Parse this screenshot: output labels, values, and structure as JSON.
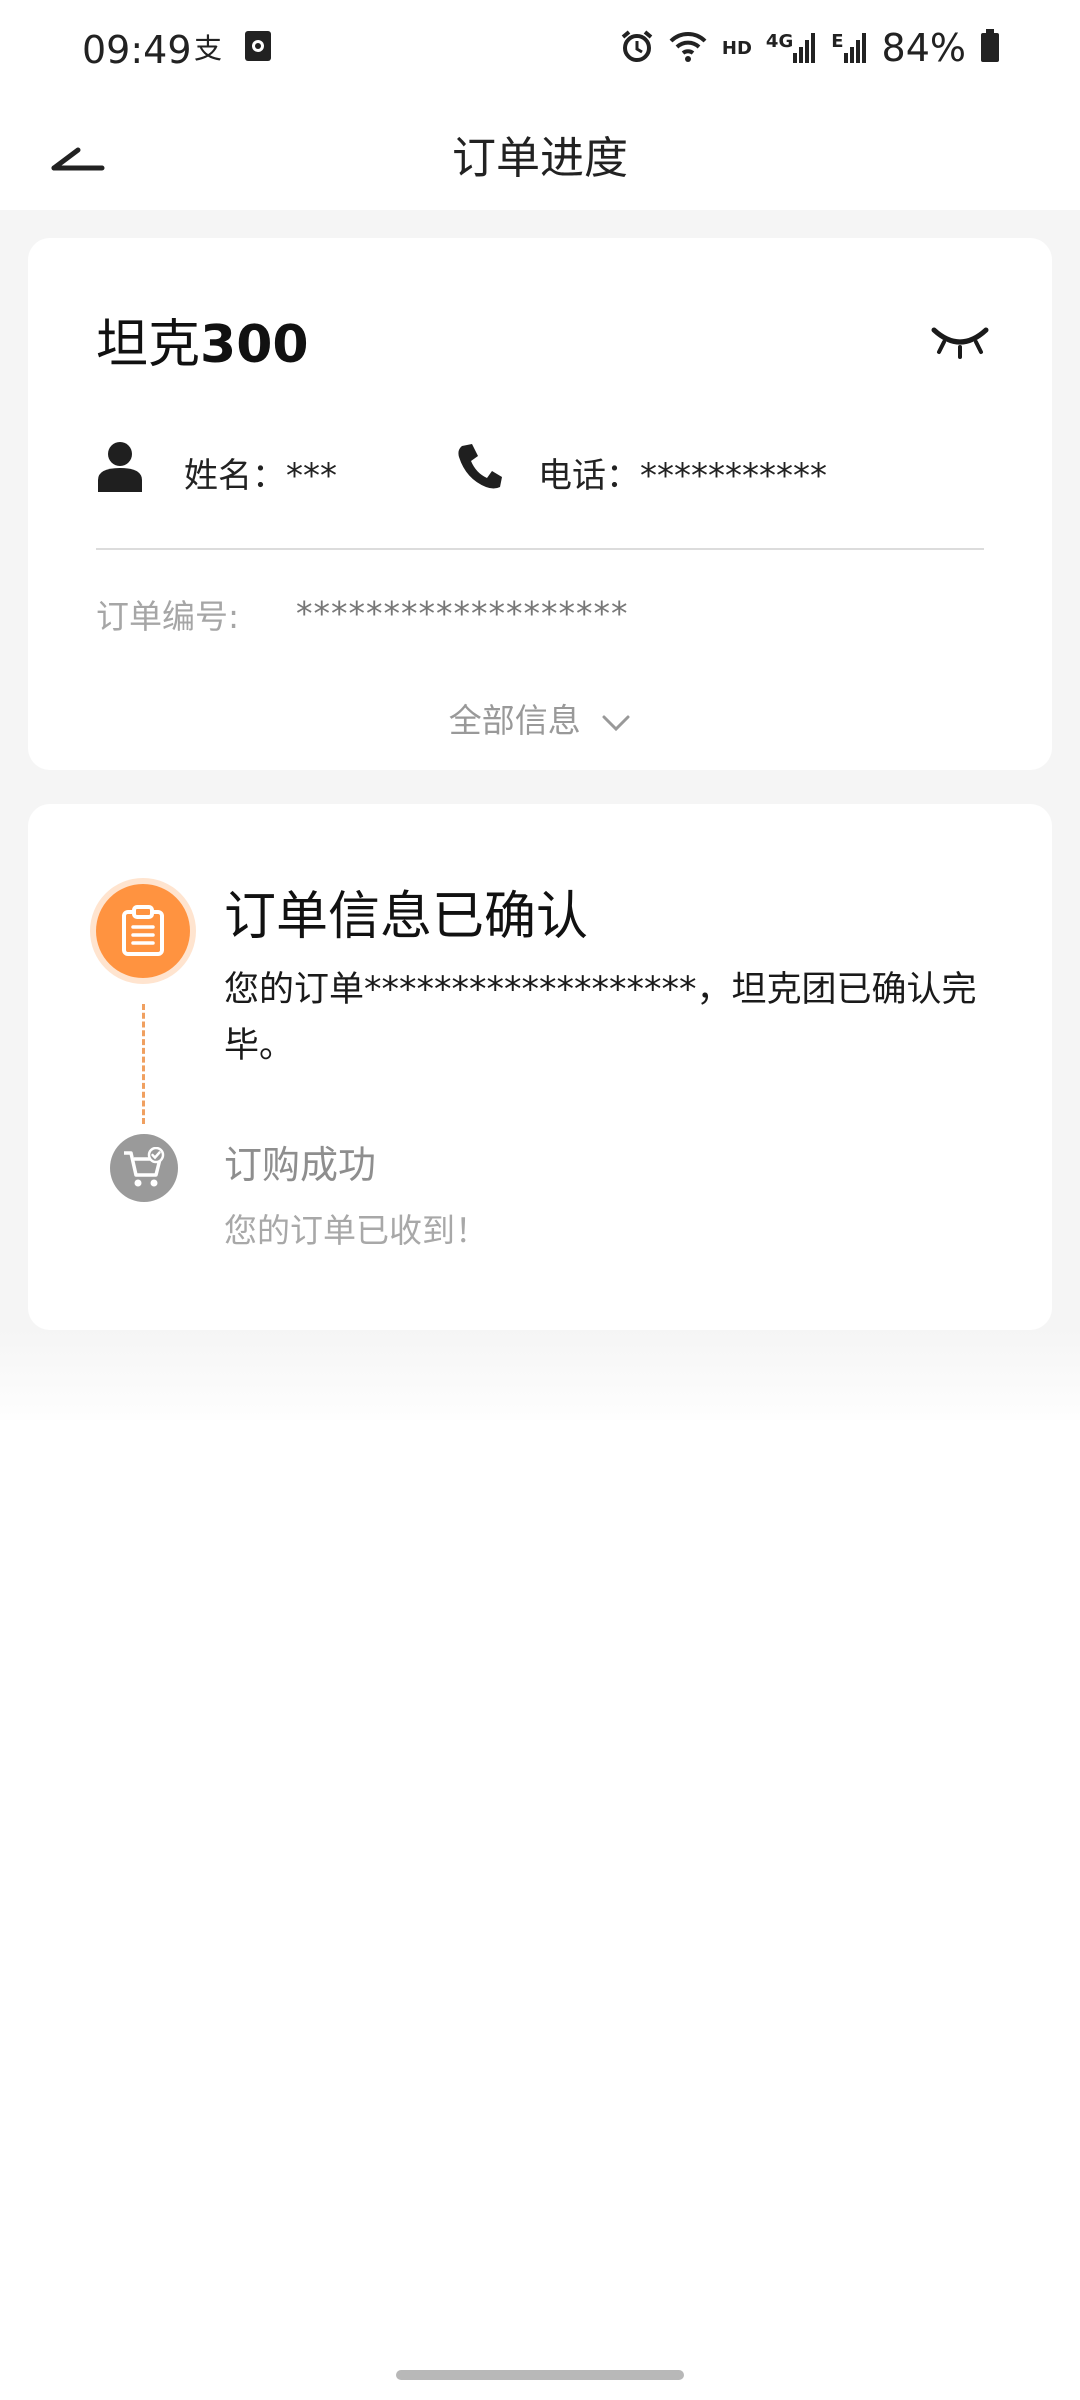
{
  "status_bar": {
    "time": "09:49",
    "left_icons": [
      "alipay-icon",
      "app-notification-icon"
    ],
    "right_icons": [
      "alarm-icon",
      "wifi-icon",
      "hd-icon",
      "signal-4g-icon",
      "signal-e-icon",
      "battery-icon"
    ],
    "hd_label": "HD",
    "net_4g_label": "4G",
    "net_e_label": "E",
    "battery": "84%"
  },
  "header": {
    "title": "订单进度"
  },
  "order_card": {
    "model_prefix": "坦克",
    "model_number": "300",
    "name_text": "姓名：***",
    "phone_text": "电话：***********",
    "order_no_label": "订单编号:",
    "order_no_value": "*******************",
    "all_info_label": "全部信息"
  },
  "progress": {
    "steps": [
      {
        "title": "订单信息已确认",
        "desc": "您的订单*******************，坦克团已确认完毕。",
        "status": "active",
        "icon": "clipboard-icon"
      },
      {
        "title": "订购成功",
        "desc": "您的订单已收到！",
        "status": "inactive",
        "icon": "cart-check-icon"
      }
    ]
  },
  "colors": {
    "accent": "#ff9340",
    "inactive": "#9a9a9a",
    "background": "#f5f5f5"
  }
}
